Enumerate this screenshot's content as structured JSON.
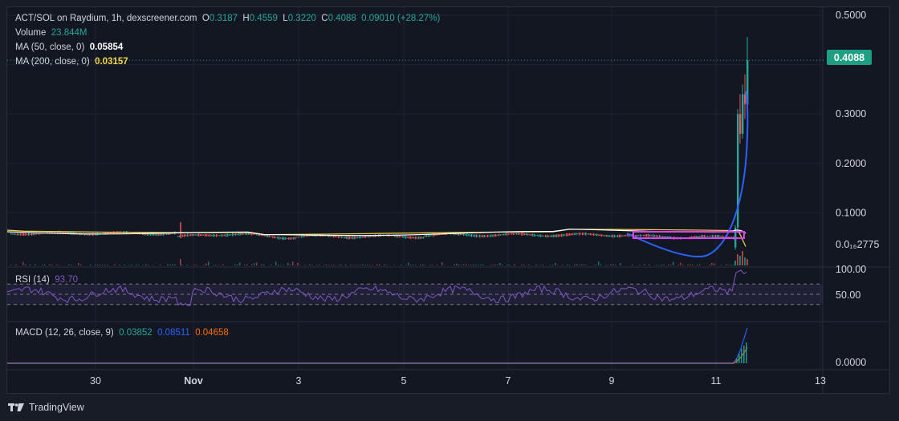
{
  "legend": {
    "symbol": "ACT/SOL on Raydium, 1h, dexscreener.com",
    "o_label": "O",
    "o_value": "0.3187",
    "h_label": "H",
    "h_value": "0.4559",
    "l_label": "L",
    "l_value": "0.3220",
    "c_label": "C",
    "c_value": "0.4088",
    "change": "0.09010 (+28.27%)",
    "volume_label": "Volume",
    "volume_value": "23.844M",
    "ma50_label": "MA (50, close, 0)",
    "ma50_value": "0.05854",
    "ma200_label": "MA (200, close, 0)",
    "ma200_value": "0.03157"
  },
  "price_badge": "0.4088",
  "price_axis": [
    "0.5000",
    "0.3000",
    "0.2000",
    "0.1000",
    "0.0₁₆2775"
  ],
  "rsi": {
    "label": "RSI (14)",
    "value": "93.70",
    "axis": [
      "100.00",
      "50.00"
    ]
  },
  "macd": {
    "label": "MACD (12, 26, close, 9)",
    "v1": "0.03852",
    "v2": "0.08511",
    "v3": "0.04658",
    "axis": [
      "0.0000"
    ]
  },
  "time_axis": [
    "30",
    "Nov",
    "3",
    "5",
    "7",
    "9",
    "11",
    "13"
  ],
  "branding": "TradingView",
  "colors": {
    "bg": "#131722",
    "up": "#26a69a",
    "down": "#ef5350",
    "ma50": "#ffffff",
    "ma200": "#f2d649",
    "rsi": "#7e57c2",
    "macd": "#2962ff",
    "signal": "#ff6d00",
    "badge": "#1e9e82",
    "annotation_curve": "#2962ff",
    "annotation_box": "#e040fb"
  },
  "chart_data": [
    {
      "type": "candlestick",
      "title": "ACT/SOL on Raydium, 1h, dexscreener.com",
      "x": [
        "30",
        "Nov",
        "3",
        "5",
        "7",
        "9",
        "11",
        "13"
      ],
      "ylim": [
        0,
        0.5
      ],
      "series": [
        {
          "name": "ACT/SOL",
          "points": [
            [
              "29",
              0.03
            ],
            [
              "30",
              0.031
            ],
            [
              "31",
              0.032
            ],
            [
              "Nov",
              0.028
            ],
            [
              "2",
              0.031
            ],
            [
              "3",
              0.025
            ],
            [
              "4",
              0.026
            ],
            [
              "5",
              0.027
            ],
            [
              "6",
              0.026
            ],
            [
              "7",
              0.028
            ],
            [
              "8",
              0.027
            ],
            [
              "9",
              0.024
            ],
            [
              "10",
              0.026
            ],
            [
              "11",
              0.03
            ],
            [
              "11.3",
              0.3187
            ],
            [
              "11.5",
              0.4088
            ]
          ]
        },
        {
          "name": "MA (50, close, 0)",
          "last": 0.05854
        },
        {
          "name": "MA (200, close, 0)",
          "last": 0.03157
        }
      ],
      "ohlc_last": {
        "open": 0.3187,
        "high": 0.4559,
        "low": 0.322,
        "close": 0.4088
      }
    },
    {
      "type": "line",
      "title": "RSI (14)",
      "ylim": [
        0,
        100
      ],
      "series": [
        {
          "name": "RSI (14)",
          "last": 93.7
        }
      ]
    },
    {
      "type": "line",
      "title": "MACD (12, 26, close, 9)",
      "series": [
        {
          "name": "MACD",
          "last": 0.03852
        },
        {
          "name": "Signal",
          "last": 0.08511
        },
        {
          "name": "Histogram",
          "last": 0.04658
        }
      ]
    }
  ]
}
